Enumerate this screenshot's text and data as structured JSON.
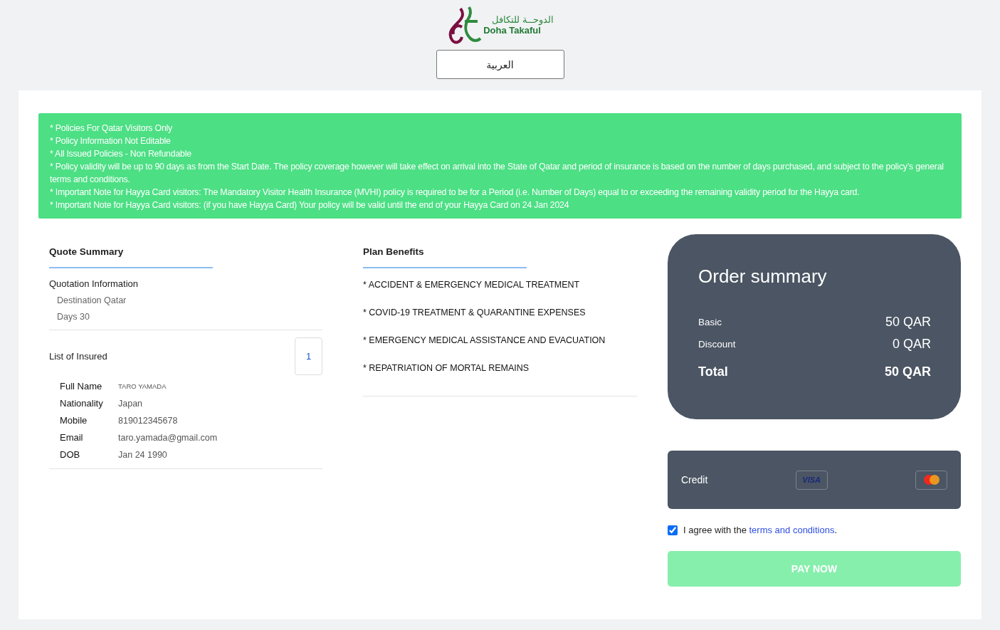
{
  "header": {
    "logo_arabic": "الدوحــة للتكافل",
    "logo_text": "Doha Takaful",
    "language_button": "العربية"
  },
  "notices": [
    "* Policies For Qatar Visitors Only",
    "* Policy Information Not Editable",
    "* All Issued Policies - Non Refundable",
    "* Policy validity will be up to 90 days as from the Start Date. The policy coverage however will take effect on arrival into the State of Qatar and period of insurance is based on the number of days purchased, and subject to the policy’s general terms and conditions.",
    "* Important Note for Hayya Card visitors: The Mandatory Visitor Health Insurance (MVHI) policy is required to be for a Period (i.e. Number of Days) equal to or exceeding the remaining validity period for the Hayya card.",
    "* Important Note for Hayya Card visitors: (if you have Hayya Card) Your policy will be valid until the end of your Hayya Card on 24 Jan 2024"
  ],
  "quote_summary": {
    "title": "Quote Summary",
    "section": "Quotation Information",
    "items": [
      "Destination Qatar",
      "Days 30"
    ],
    "insured_title": "List of Insured",
    "insured_count": "1",
    "insured": [
      {
        "label": "Full Name",
        "value": "TARO YAMADA",
        "kind": "caps"
      },
      {
        "label": "Nationality",
        "value": "Japan",
        "kind": "plain"
      },
      {
        "label": "Mobile",
        "value": "819012345678",
        "kind": "plain"
      },
      {
        "label": "Email",
        "value": "taro.yamada@gmail.com",
        "kind": "plain"
      },
      {
        "label": "DOB",
        "value": "Jan 24 1990",
        "kind": "plain"
      }
    ]
  },
  "plan_benefits": {
    "title": "Plan Benefits",
    "items": [
      "* ACCIDENT & EMERGENCY MEDICAL TREATMENT",
      "* COVID-19 TREATMENT & QUARANTINE EXPENSES",
      "* EMERGENCY MEDICAL ASSISTANCE AND EVACUATION",
      "* REPATRIATION OF MORTAL REMAINS"
    ]
  },
  "order_summary": {
    "title": "Order summary",
    "lines": [
      {
        "label": "Basic",
        "value": "50 QAR",
        "kind": "line"
      },
      {
        "label": "Discount",
        "value": "0 QAR",
        "kind": "line"
      },
      {
        "label": "Total",
        "value": "50 QAR",
        "kind": "total"
      }
    ]
  },
  "payment": {
    "label": "Credit",
    "visa": "VISA"
  },
  "agree": {
    "checked": true,
    "text": "I agree with the ",
    "link": "terms and conditions",
    "after": "."
  },
  "pay_button": {
    "label": "PAY NOW",
    "disabled": true
  }
}
